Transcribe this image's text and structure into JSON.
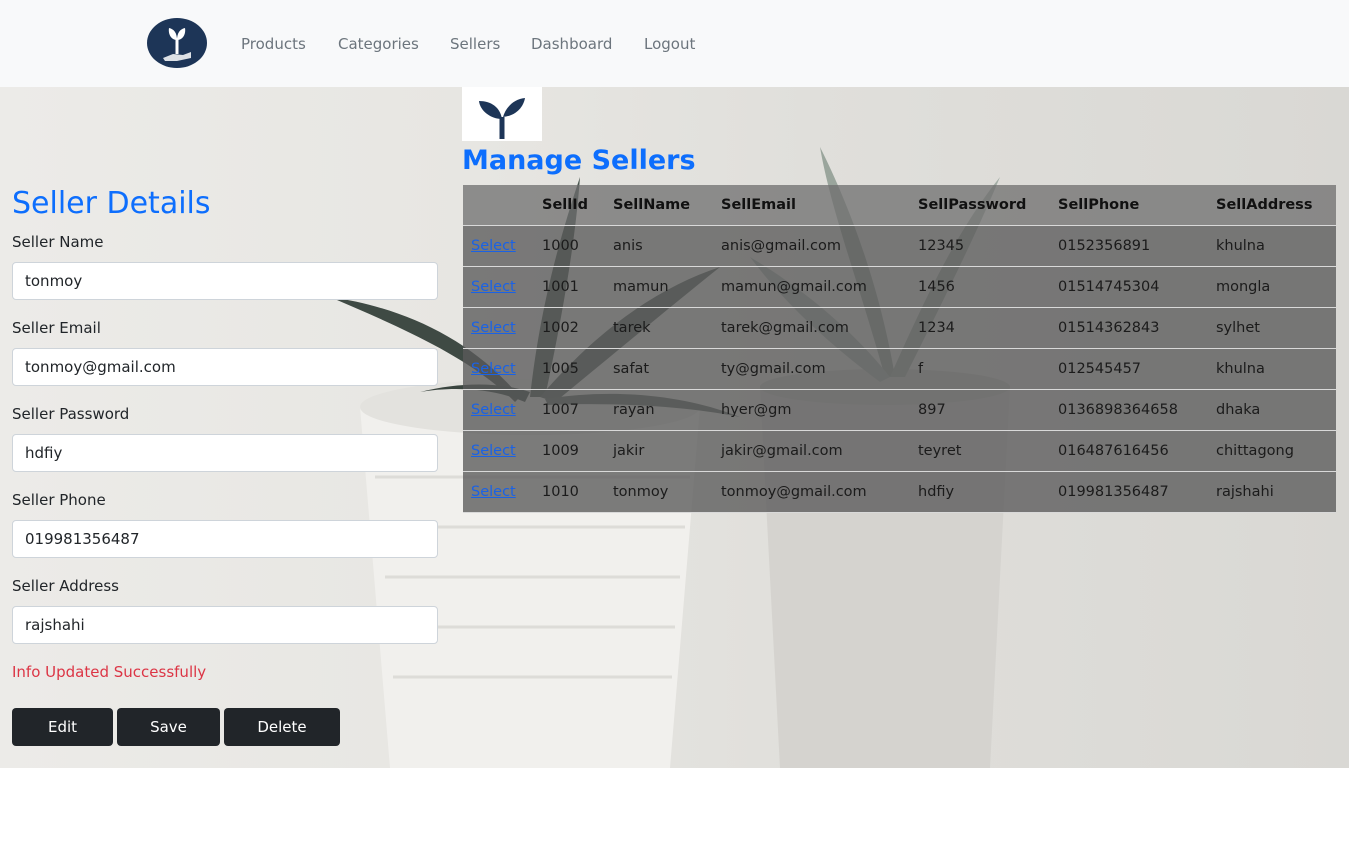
{
  "nav": {
    "links": [
      "Products",
      "Categories",
      "Sellers",
      "Dashboard",
      "Logout"
    ]
  },
  "form": {
    "title": "Seller Details",
    "fields": [
      {
        "label": "Seller Name",
        "value": "tonmoy"
      },
      {
        "label": "Seller Email",
        "value": "tonmoy@gmail.com"
      },
      {
        "label": "Seller Password",
        "value": "hdfiy"
      },
      {
        "label": "Seller Phone",
        "value": "019981356487"
      },
      {
        "label": "Seller Address",
        "value": "rajshahi"
      }
    ],
    "status": "Info Updated Successfully",
    "buttons": {
      "edit": "Edit",
      "save": "Save",
      "delete": "Delete"
    }
  },
  "table": {
    "title": "Manage Sellers",
    "select_label": "Select",
    "headers": [
      "",
      "SellId",
      "SellName",
      "SellEmail",
      "SellPassword",
      "SellPhone",
      "SellAddress"
    ],
    "rows": [
      [
        "1000",
        "anis",
        "anis@gmail.com",
        "12345",
        "0152356891",
        "khulna"
      ],
      [
        "1001",
        "mamun",
        "mamun@gmail.com",
        "1456",
        "01514745304",
        "mongla"
      ],
      [
        "1002",
        "tarek",
        "tarek@gmail.com",
        "1234",
        "01514362843",
        "sylhet"
      ],
      [
        "1005",
        "safat",
        "ty@gmail.com",
        "f",
        "012545457",
        "khulna"
      ],
      [
        "1007",
        "rayan",
        "hyer@gm",
        "897",
        "0136898364658",
        "dhaka"
      ],
      [
        "1009",
        "jakir",
        "jakir@gmail.com",
        "teyret",
        "016487616456",
        "chittagong"
      ],
      [
        "1010",
        "tonmoy",
        "tonmoy@gmail.com",
        "hdfiy",
        "019981356487",
        "rajshahi"
      ]
    ]
  },
  "colors": {
    "accent": "#0d6efd",
    "danger": "#dc3545",
    "button": "#212529",
    "navbar": "#f8f9fa",
    "logo": "#1d3557"
  },
  "icons": {
    "brand": "plant-hand-icon",
    "small_brand": "sprout-icon"
  }
}
